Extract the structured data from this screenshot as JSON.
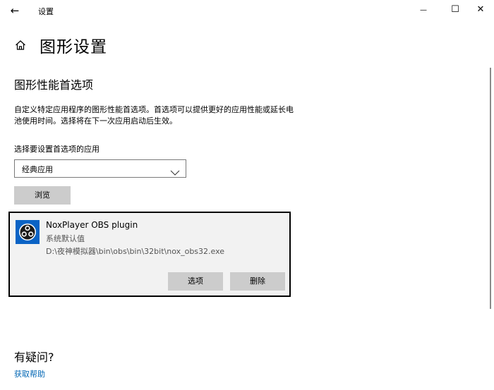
{
  "window": {
    "title": "设置",
    "back_glyph": "←",
    "minimize_glyph": "—",
    "maximize_glyph": "☐",
    "close_glyph": "✕"
  },
  "header": {
    "title": "图形设置"
  },
  "section": {
    "title": "图形性能首选项",
    "description": "自定义特定应用程序的图形性能首选项。首选项可以提供更好的应用性能或延长电池使用时间。选择将在下一次应用启动后生效。",
    "select_label": "选择要设置首选项的应用",
    "select_value": "经典应用",
    "browse_label": "浏览"
  },
  "app_entry": {
    "name": "NoxPlayer OBS plugin",
    "preference": "系统默认值",
    "path": "D:\\夜神模拟器\\bin\\obs\\bin\\32bit\\nox_obs32.exe",
    "options_label": "选项",
    "remove_label": "删除",
    "icon_color": "#0a63c5"
  },
  "help": {
    "title": "有疑问?",
    "link": "获取帮助",
    "link_color": "#0066b4"
  }
}
